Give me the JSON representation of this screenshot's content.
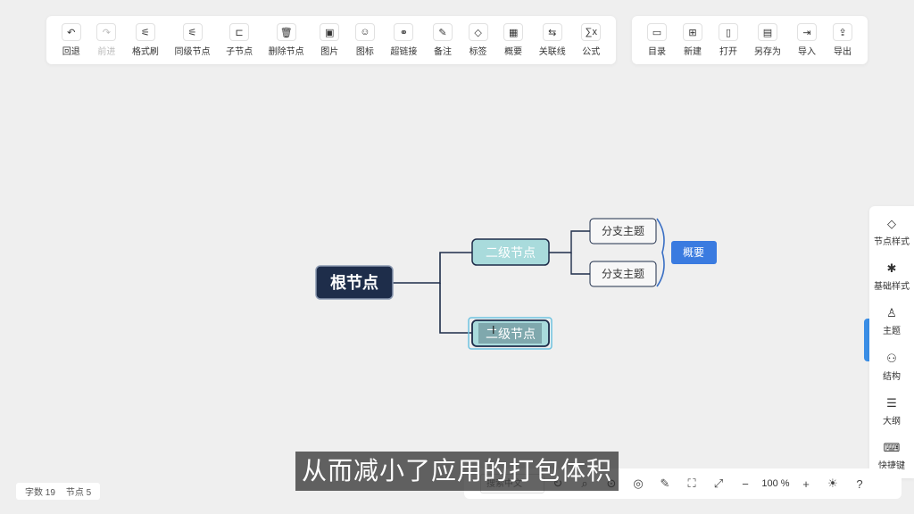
{
  "toolbar_left": [
    {
      "label": "回退",
      "icon": "undo-icon",
      "glyph": "↶",
      "disabled": false
    },
    {
      "label": "前进",
      "icon": "redo-icon",
      "glyph": "↷",
      "disabled": true
    },
    {
      "label": "格式刷",
      "icon": "format-brush-icon",
      "glyph": "⚟",
      "disabled": false
    },
    {
      "label": "同级节点",
      "icon": "sibling-node-icon",
      "glyph": "⚟",
      "disabled": false
    },
    {
      "label": "子节点",
      "icon": "child-node-icon",
      "glyph": "⊏",
      "disabled": false
    },
    {
      "label": "删除节点",
      "icon": "trash-icon",
      "glyph": "🗑",
      "disabled": false
    },
    {
      "label": "图片",
      "icon": "image-icon",
      "glyph": "▣",
      "disabled": false
    },
    {
      "label": "图标",
      "icon": "smiley-icon",
      "glyph": "☺",
      "disabled": false
    },
    {
      "label": "超链接",
      "icon": "link-icon",
      "glyph": "⚭",
      "disabled": false
    },
    {
      "label": "备注",
      "icon": "note-icon",
      "glyph": "✎",
      "disabled": false
    },
    {
      "label": "标签",
      "icon": "tag-icon",
      "glyph": "◇",
      "disabled": false
    },
    {
      "label": "概要",
      "icon": "summary-icon",
      "glyph": "▦",
      "disabled": false
    },
    {
      "label": "关联线",
      "icon": "relation-line-icon",
      "glyph": "⇆",
      "disabled": false
    },
    {
      "label": "公式",
      "icon": "formula-icon",
      "glyph": "∑x",
      "disabled": false
    }
  ],
  "toolbar_right": [
    {
      "label": "目录",
      "icon": "folder-icon",
      "glyph": "▭"
    },
    {
      "label": "新建",
      "icon": "new-file-icon",
      "glyph": "⊞"
    },
    {
      "label": "打开",
      "icon": "open-file-icon",
      "glyph": "▯"
    },
    {
      "label": "另存为",
      "icon": "save-as-icon",
      "glyph": "▤"
    },
    {
      "label": "导入",
      "icon": "import-icon",
      "glyph": "⇥"
    },
    {
      "label": "导出",
      "icon": "export-icon",
      "glyph": "⇪"
    }
  ],
  "sidebar": [
    {
      "label": "节点样式",
      "icon": "node-style-icon",
      "glyph": "◇"
    },
    {
      "label": "基础样式",
      "icon": "base-style-icon",
      "glyph": "✱"
    },
    {
      "label": "主题",
      "icon": "theme-shirt-icon",
      "glyph": "♙"
    },
    {
      "label": "结构",
      "icon": "structure-icon",
      "glyph": "⚇"
    },
    {
      "label": "大纲",
      "icon": "outline-icon",
      "glyph": "☰"
    },
    {
      "label": "快捷键",
      "icon": "keyboard-icon",
      "glyph": "⌨"
    }
  ],
  "mindmap": {
    "root": "根节点",
    "second_level_1": "二级节点",
    "second_level_2": "二级节点",
    "branch_1": "分支主题",
    "branch_2": "分支主题",
    "summary": "概要"
  },
  "status": {
    "word_count": "字数 19",
    "node_count": "节点 5"
  },
  "bottombar": {
    "search_placeholder": "搜索中文",
    "zoom": "100 %"
  },
  "subtitle": "从而减小了应用的打包体积",
  "colors": {
    "root_bg": "#1e2d4a",
    "second_level_bg": "#a9dbdc",
    "summary_bg": "#3a7be0",
    "accent": "#3a8ee6"
  }
}
